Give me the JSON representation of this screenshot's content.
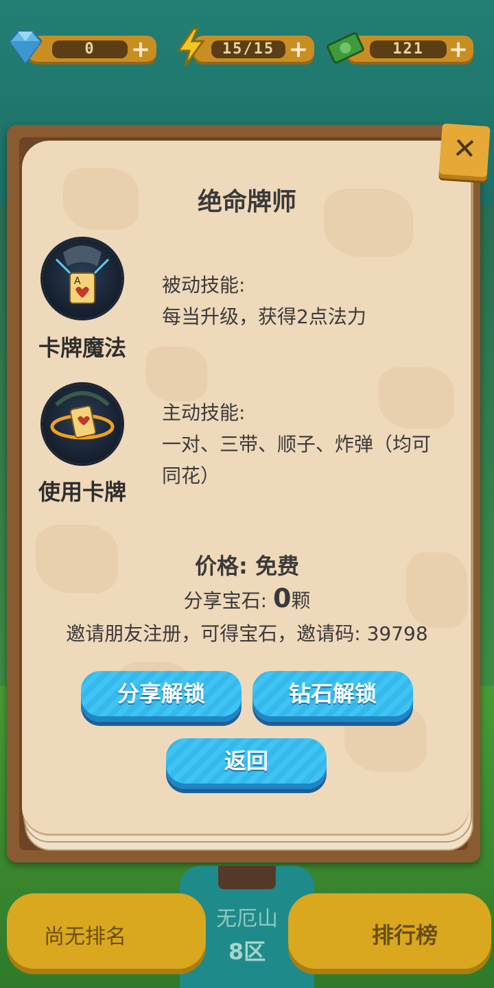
{
  "resources": {
    "gems": "0",
    "energy": "15/15",
    "cash": "121"
  },
  "modal": {
    "title": "绝命牌师",
    "skills": [
      {
        "name": "卡牌魔法",
        "type_label": "被动技能:",
        "description": "每当升级，获得2点法力"
      },
      {
        "name": "使用卡牌",
        "type_label": "主动技能:",
        "description_line1": "一对、三带、顺子、炸弹（均可",
        "description_line2": "同花）"
      }
    ],
    "price_label": "价格: 免费",
    "share_gems_prefix": "分享宝石: ",
    "share_gems_count": "0",
    "share_gems_suffix": "颗",
    "invite_text": "邀请朋友注册，可得宝石，邀请码: 39798",
    "buttons": {
      "share_unlock": "分享解锁",
      "diamond_unlock": "钻石解锁",
      "back": "返回"
    }
  },
  "bottom_bar": {
    "rank": "尚无排名",
    "server_name": "无厄山",
    "server_zone": "8区",
    "leaderboard": "排行榜"
  },
  "colors": {
    "button_blue": "#3fc4f3",
    "panel_bg": "#efd9bb",
    "frame_brown": "#8a5a30",
    "gold": "#d9a81e"
  }
}
